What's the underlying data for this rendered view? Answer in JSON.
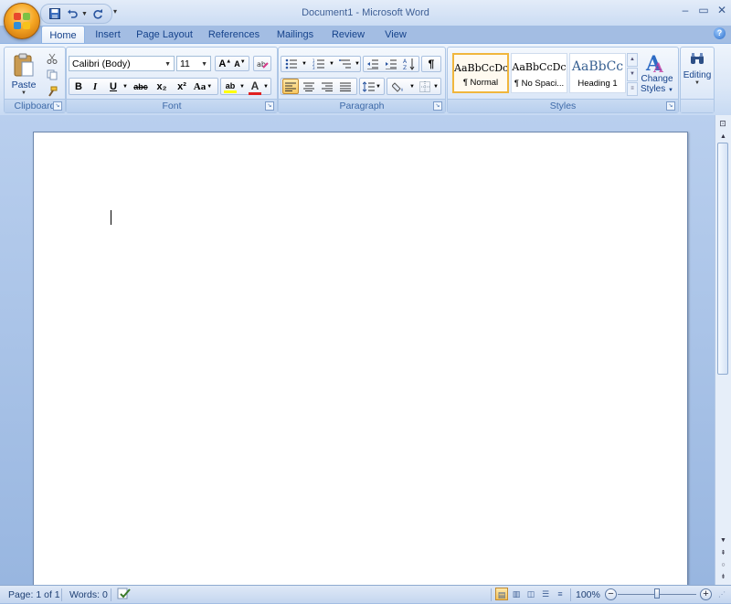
{
  "window": {
    "title": "Document1 - Microsoft Word",
    "controls": [
      "–",
      "▭",
      "✕"
    ]
  },
  "quick_access": {
    "save_icon": "save-icon",
    "undo_icon": "undo-icon",
    "redo_icon": "redo-icon"
  },
  "tabs": [
    {
      "label": "Home",
      "active": true
    },
    {
      "label": "Insert"
    },
    {
      "label": "Page Layout"
    },
    {
      "label": "References"
    },
    {
      "label": "Mailings"
    },
    {
      "label": "Review"
    },
    {
      "label": "View"
    }
  ],
  "clipboard": {
    "paste_label": "Paste",
    "group_label": "Clipboard"
  },
  "font": {
    "family": "Calibri (Body)",
    "size": "11",
    "group_label": "Font",
    "bold": "B",
    "italic": "I",
    "underline": "U",
    "strikethrough": "abc",
    "subscript": "x₂",
    "superscript": "x²",
    "change_case": "Aa",
    "grow": "A",
    "shrink": "A",
    "highlight": "ab",
    "font_color": "A",
    "font_color_hex": "#e02020",
    "highlight_hex": "#ffff00"
  },
  "paragraph": {
    "group_label": "Paragraph",
    "show_marks": "¶"
  },
  "styles": {
    "group_label": "Styles",
    "items": [
      {
        "sample": "AaBbCcDc",
        "name": "¶ Normal",
        "selected": true
      },
      {
        "sample": "AaBbCcDc",
        "name": "¶ No Spaci..."
      },
      {
        "sample": "AaBbCc",
        "name": "Heading 1"
      }
    ],
    "change_styles_line1": "Change",
    "change_styles_line2": "Styles",
    "heading_color": "#365f91"
  },
  "editing": {
    "label": "Editing"
  },
  "status": {
    "page": "Page: 1 of 1",
    "words": "Words: 0",
    "zoom": "100%"
  },
  "colors": {
    "accent": "#15428b",
    "ribbon_border": "#8db2e3",
    "active_style_border": "#f0b63d"
  }
}
